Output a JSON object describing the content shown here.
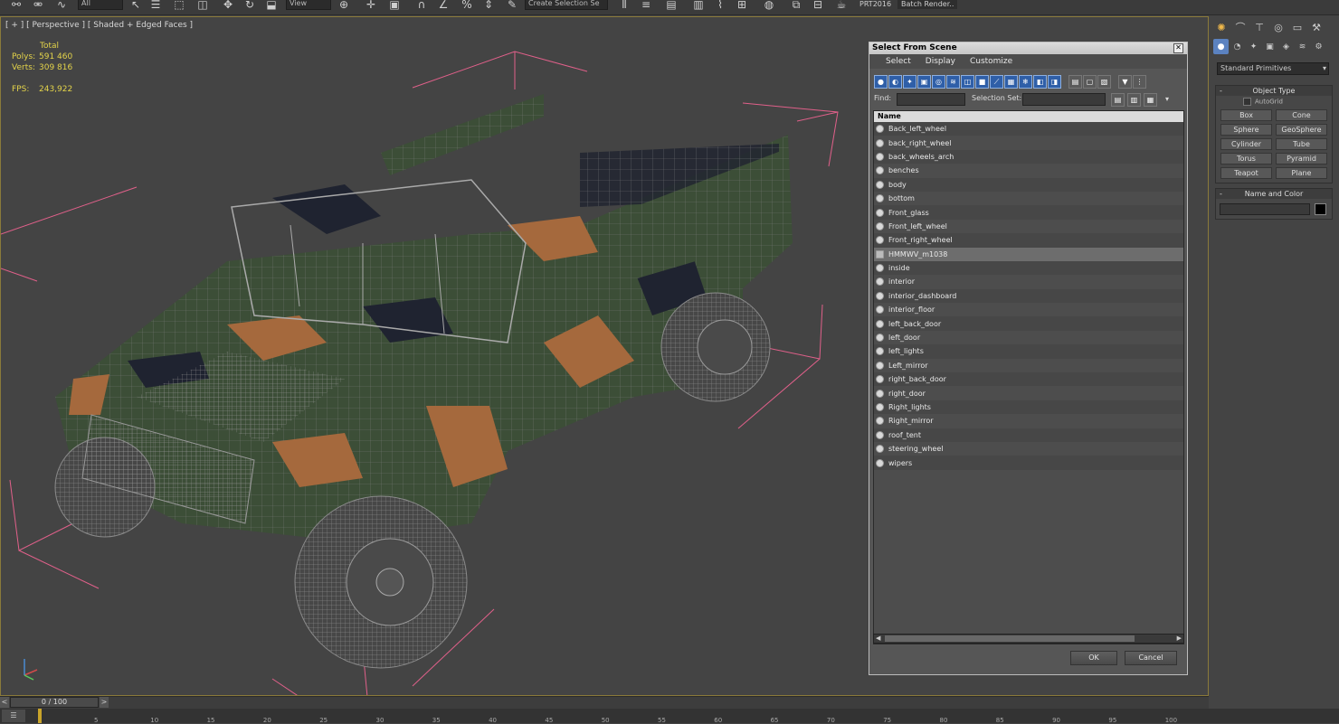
{
  "toolbar": {
    "combo_all": "All",
    "combo_view": "View",
    "selection_set": "Create Selection Se",
    "project_label": "PRT2016",
    "batch_render": "Batch Render.."
  },
  "viewport": {
    "label": "[ + ] [ Perspective ] [ Shaded + Edged Faces ]",
    "stats": {
      "header": "Total",
      "polys_label": "Polys:",
      "polys": "591 460",
      "verts_label": "Verts:",
      "verts": "309 816",
      "fps_label": "FPS:",
      "fps": "243,922"
    }
  },
  "dialog": {
    "title": "Select From Scene",
    "menus": [
      "Select",
      "Display",
      "Customize"
    ],
    "find_label": "Find:",
    "selection_set_label": "Selection Set:",
    "column_header": "Name",
    "items": [
      {
        "name": "Back_left_wheel",
        "selected": false,
        "type": "mesh"
      },
      {
        "name": "back_right_wheel",
        "selected": false,
        "type": "mesh"
      },
      {
        "name": "back_wheels_arch",
        "selected": false,
        "type": "mesh"
      },
      {
        "name": "benches",
        "selected": false,
        "type": "mesh"
      },
      {
        "name": "body",
        "selected": false,
        "type": "mesh"
      },
      {
        "name": "bottom",
        "selected": false,
        "type": "mesh"
      },
      {
        "name": "Front_glass",
        "selected": false,
        "type": "mesh"
      },
      {
        "name": "Front_left_wheel",
        "selected": false,
        "type": "mesh"
      },
      {
        "name": "Front_right_wheel",
        "selected": false,
        "type": "mesh"
      },
      {
        "name": "HMMWV_m1038",
        "selected": true,
        "type": "group"
      },
      {
        "name": "inside",
        "selected": false,
        "type": "mesh"
      },
      {
        "name": "interior",
        "selected": false,
        "type": "mesh"
      },
      {
        "name": "interior_dashboard",
        "selected": false,
        "type": "mesh"
      },
      {
        "name": "interior_floor",
        "selected": false,
        "type": "mesh"
      },
      {
        "name": "left_back_door",
        "selected": false,
        "type": "mesh"
      },
      {
        "name": "left_door",
        "selected": false,
        "type": "mesh"
      },
      {
        "name": "left_lights",
        "selected": false,
        "type": "mesh"
      },
      {
        "name": "Left_mirror",
        "selected": false,
        "type": "mesh"
      },
      {
        "name": "right_back_door",
        "selected": false,
        "type": "mesh"
      },
      {
        "name": "right_door",
        "selected": false,
        "type": "mesh"
      },
      {
        "name": "Right_lights",
        "selected": false,
        "type": "mesh"
      },
      {
        "name": "Right_mirror",
        "selected": false,
        "type": "mesh"
      },
      {
        "name": "roof_tent",
        "selected": false,
        "type": "mesh"
      },
      {
        "name": "steering_wheel",
        "selected": false,
        "type": "mesh"
      },
      {
        "name": "wipers",
        "selected": false,
        "type": "mesh"
      }
    ],
    "ok_label": "OK",
    "cancel_label": "Cancel"
  },
  "command_panel": {
    "category": "Standard Primitives",
    "object_type_title": "Object Type",
    "autogrid_label": "AutoGrid",
    "primitives": [
      "Box",
      "Cone",
      "Sphere",
      "GeoSphere",
      "Cylinder",
      "Tube",
      "Torus",
      "Pyramid",
      "Teapot",
      "Plane"
    ],
    "name_color_title": "Name and Color",
    "object_color": "#000000"
  },
  "timeline": {
    "frame": "0 / 100",
    "ticks": [
      "5",
      "10",
      "15",
      "20",
      "25",
      "30",
      "35",
      "40",
      "45",
      "50",
      "55",
      "60",
      "65",
      "70",
      "75",
      "80",
      "85",
      "90",
      "95",
      "100"
    ]
  },
  "colors": {
    "viewport_bg": "#444444",
    "dialog_selection": "#6d6d6d",
    "stats_text": "#e3d34a",
    "bounding_box": "#e0608a"
  }
}
